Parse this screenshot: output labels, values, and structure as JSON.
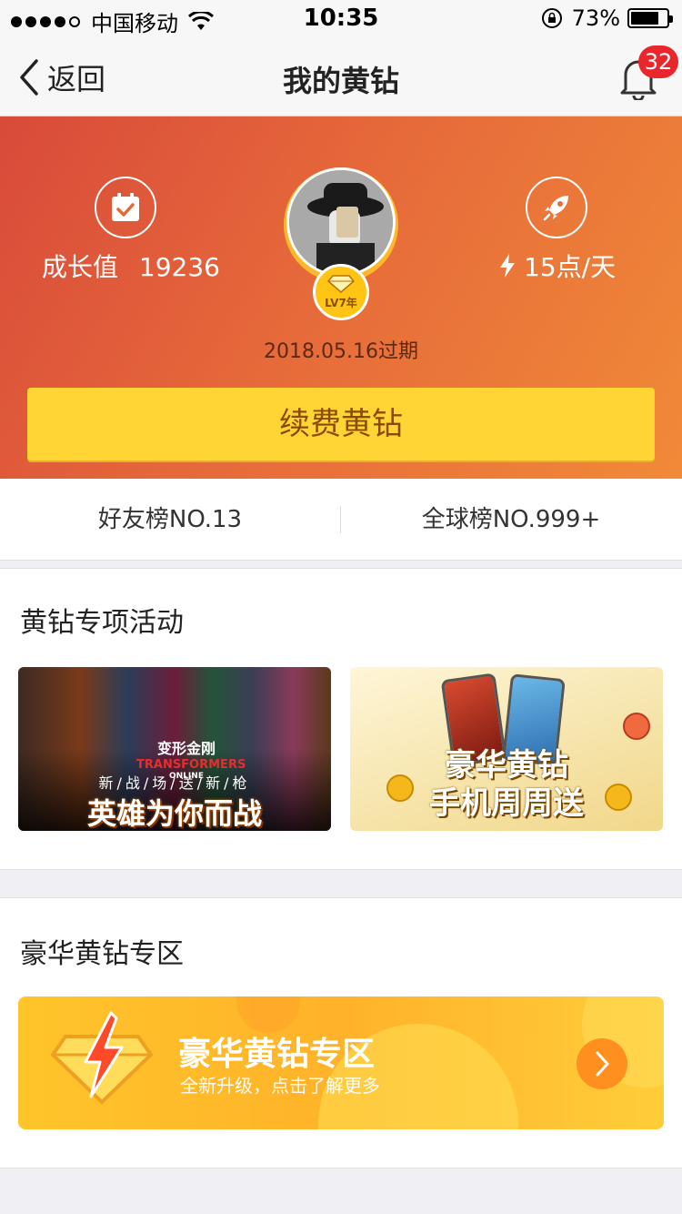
{
  "status_bar": {
    "carrier": "中国移动",
    "time": "10:35",
    "battery": "73%"
  },
  "nav": {
    "back_label": "返回",
    "title": "我的黄钻",
    "badge_count": "32"
  },
  "hero": {
    "growth_label": "成长值",
    "growth_value": "19236",
    "speed_label": "15点/天",
    "level": "LV7年",
    "expire": "2018.05.16过期",
    "renew_label": "续费黄钻"
  },
  "rank": {
    "friends": "好友榜NO.13",
    "global": "全球榜NO.999+"
  },
  "activities": {
    "heading": "黄钻专项活动",
    "banner1": {
      "logo_cn": "变形金刚",
      "logo_en": "TRANSFORMERS",
      "logo_sub": "ONLINE",
      "subtitle": "新/战/场/送/新/枪",
      "title": "英雄为你而战"
    },
    "banner2": {
      "title1": "豪华黄钻",
      "title2": "手机周周送"
    }
  },
  "deluxe": {
    "heading": "豪华黄钻专区",
    "card_title": "豪华黄钻专区",
    "card_subtitle": "全新升级，点击了解更多"
  }
}
